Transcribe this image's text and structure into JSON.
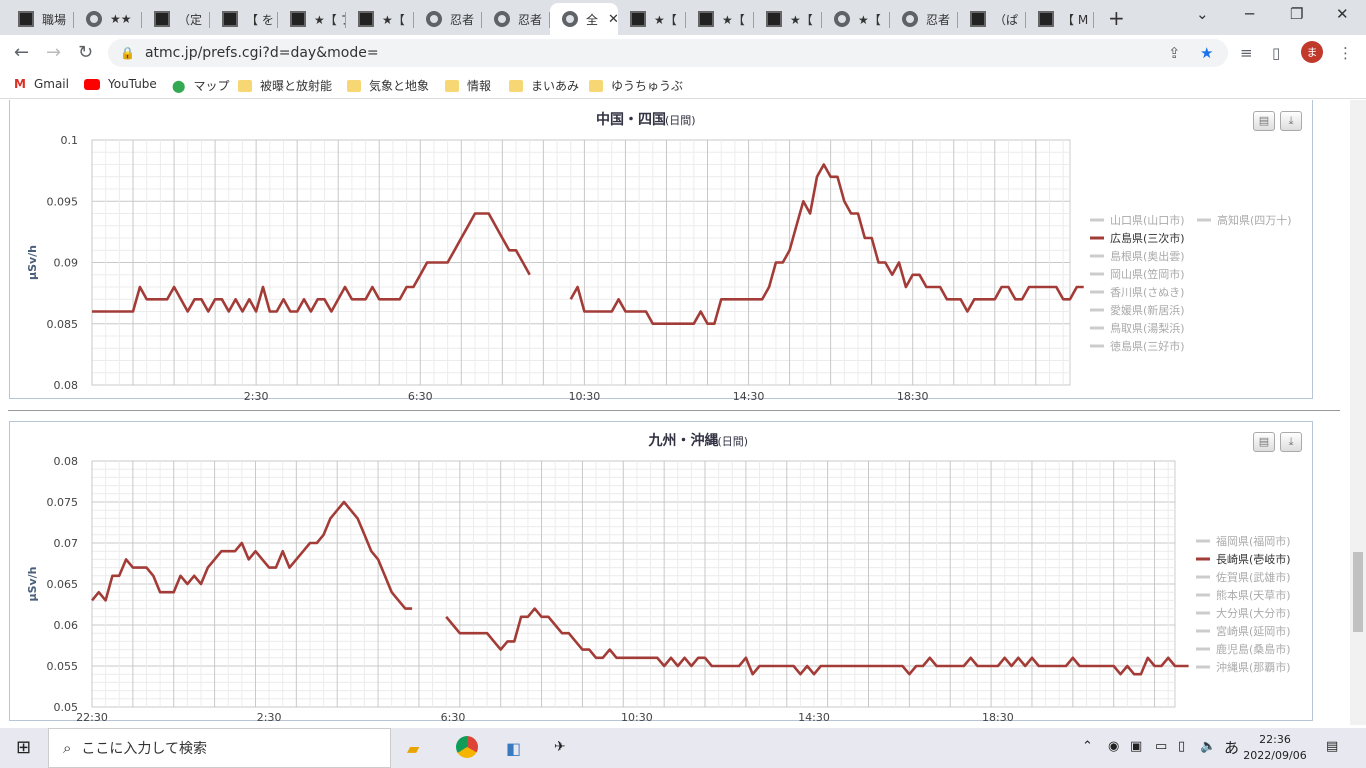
{
  "tabs": [
    {
      "label": "職場",
      "icon": "site-icon"
    },
    {
      "label": "★★",
      "icon": "globe-icon"
    },
    {
      "label": "（定",
      "icon": "site-icon"
    },
    {
      "label": "【 を",
      "icon": "site-icon"
    },
    {
      "label": "★【 プ",
      "icon": "site-icon"
    },
    {
      "label": "★【",
      "icon": "site-icon"
    },
    {
      "label": "忍者",
      "icon": "globe-icon"
    },
    {
      "label": "忍者",
      "icon": "globe-icon"
    },
    {
      "label": "全",
      "icon": "globe-icon"
    },
    {
      "label": "★【",
      "icon": "site-icon"
    },
    {
      "label": "★【",
      "icon": "site-icon"
    },
    {
      "label": "★【",
      "icon": "site-icon"
    },
    {
      "label": "★【",
      "icon": "globe-icon"
    },
    {
      "label": "忍者",
      "icon": "globe-icon"
    },
    {
      "label": "（ぱ",
      "icon": "site-icon"
    },
    {
      "label": "【 M",
      "icon": "site-icon"
    }
  ],
  "url": "atmc.jp/prefs.cgi?d=day&mode=",
  "bookmarks": [
    "Gmail",
    "YouTube",
    "マップ",
    "被曝と放射能",
    "気象と地象",
    "情報",
    "まいあみ",
    "ゆうちゅうぶ"
  ],
  "taskbar": {
    "search_placeholder": "ここに入力して検索",
    "time": "22:36",
    "date": "2022/09/06",
    "ime": "あ"
  },
  "chart_data": [
    {
      "type": "line",
      "title": "中国・四国",
      "subtitle": "(日間)",
      "ylabel": "µSv/h",
      "ylim": [
        0.08,
        0.1
      ],
      "yticks": [
        "0.1",
        "0.095",
        "0.09",
        "0.085",
        "0.08"
      ],
      "xticklabels": [
        {
          "label": "2:30",
          "index": 24
        },
        {
          "label": "6:30",
          "index": 48
        },
        {
          "label": "10:30",
          "index": 72
        },
        {
          "label": "14:30",
          "index": 96
        },
        {
          "label": "18:30",
          "index": 120
        }
      ],
      "n_points": 144,
      "legend": {
        "position": "right",
        "columns": [
          [
            "山口県(山口市)",
            "広島県(三次市)",
            "島根県(奥出雲)",
            "岡山県(笠岡市)",
            "香川県(さぬき)",
            "愛媛県(新居浜)",
            "鳥取県(湯梨浜)",
            "徳島県(三好市)"
          ],
          [
            "高知県(四万十)"
          ]
        ]
      },
      "highlight": "広島県(三次市)",
      "series": [
        {
          "name": "広島県(三次市)",
          "color": "#a33b37",
          "values": [
            0.086,
            0.086,
            0.086,
            0.086,
            0.086,
            0.086,
            0.086,
            0.088,
            0.087,
            0.087,
            0.087,
            0.087,
            0.088,
            0.087,
            0.086,
            0.087,
            0.087,
            0.086,
            0.087,
            0.087,
            0.086,
            0.087,
            0.086,
            0.087,
            0.086,
            0.088,
            0.086,
            0.086,
            0.087,
            0.086,
            0.086,
            0.087,
            0.086,
            0.087,
            0.087,
            0.086,
            0.087,
            0.088,
            0.087,
            0.087,
            0.087,
            0.088,
            0.087,
            0.087,
            0.087,
            0.087,
            0.088,
            0.088,
            0.089,
            0.09,
            0.09,
            0.09,
            0.09,
            0.091,
            0.092,
            0.093,
            0.094,
            0.094,
            0.094,
            0.093,
            0.092,
            0.091,
            0.091,
            0.09,
            0.089,
            null,
            null,
            null,
            null,
            null,
            0.087,
            0.088,
            0.086,
            0.086,
            0.086,
            0.086,
            0.086,
            0.087,
            0.086,
            0.086,
            0.086,
            0.086,
            0.085,
            0.085,
            0.085,
            0.085,
            0.085,
            0.085,
            0.085,
            0.086,
            0.085,
            0.085,
            0.087,
            0.087,
            0.087,
            0.087,
            0.087,
            0.087,
            0.087,
            0.088,
            0.09,
            0.09,
            0.091,
            0.093,
            0.095,
            0.094,
            0.097,
            0.098,
            0.097,
            0.097,
            0.095,
            0.094,
            0.094,
            0.092,
            0.092,
            0.09,
            0.09,
            0.089,
            0.09,
            0.088,
            0.089,
            0.089,
            0.088,
            0.088,
            0.088,
            0.087,
            0.087,
            0.087,
            0.086,
            0.087,
            0.087,
            0.087,
            0.087,
            0.088,
            0.088,
            0.087,
            0.087,
            0.088,
            0.088,
            0.088,
            0.088,
            0.088,
            0.087,
            0.087,
            0.088,
            0.088
          ]
        }
      ]
    },
    {
      "type": "line",
      "title": "九州・沖縄",
      "subtitle": "(日間)",
      "ylabel": "µSv/h",
      "ylim": [
        0.05,
        0.08
      ],
      "yticks": [
        "0.08",
        "0.075",
        "0.07",
        "0.065",
        "0.06",
        "0.055",
        "0.05"
      ],
      "xticklabels": [
        {
          "label": "22:30",
          "index": 0
        },
        {
          "label": "2:30",
          "index": 26
        },
        {
          "label": "6:30",
          "index": 53
        },
        {
          "label": "10:30",
          "index": 80
        },
        {
          "label": "14:30",
          "index": 106
        },
        {
          "label": "18:30",
          "index": 133
        }
      ],
      "n_points": 160,
      "legend": {
        "position": "right",
        "columns": [
          [
            "福岡県(福岡市)",
            "長崎県(壱岐市)",
            "佐賀県(武雄市)",
            "熊本県(天草市)",
            "大分県(大分市)",
            "宮崎県(延岡市)",
            "鹿児島(桑島市)",
            "沖縄県(那覇市)"
          ]
        ]
      },
      "highlight": "長崎県(壱岐市)",
      "series": [
        {
          "name": "長崎県(壱岐市)",
          "color": "#a33b37",
          "values": [
            0.063,
            0.064,
            0.063,
            0.066,
            0.066,
            0.068,
            0.067,
            0.067,
            0.067,
            0.066,
            0.064,
            0.064,
            0.064,
            0.066,
            0.065,
            0.066,
            0.065,
            0.067,
            0.068,
            0.069,
            0.069,
            0.069,
            0.07,
            0.068,
            0.069,
            0.068,
            0.067,
            0.067,
            0.069,
            0.067,
            0.068,
            0.069,
            0.07,
            0.07,
            0.071,
            0.073,
            0.074,
            0.075,
            0.074,
            0.073,
            0.071,
            0.069,
            0.068,
            0.066,
            0.064,
            0.063,
            0.062,
            0.062,
            null,
            null,
            null,
            null,
            0.061,
            0.06,
            0.059,
            0.059,
            0.059,
            0.059,
            0.059,
            0.058,
            0.057,
            0.058,
            0.058,
            0.061,
            0.061,
            0.062,
            0.061,
            0.061,
            0.06,
            0.059,
            0.059,
            0.058,
            0.057,
            0.057,
            0.056,
            0.056,
            0.057,
            0.056,
            0.056,
            0.056,
            0.056,
            0.056,
            0.056,
            0.056,
            0.055,
            0.056,
            0.055,
            0.056,
            0.055,
            0.056,
            0.056,
            0.055,
            0.055,
            0.055,
            0.055,
            0.055,
            0.056,
            0.054,
            0.055,
            0.055,
            0.055,
            0.055,
            0.055,
            0.055,
            0.054,
            0.055,
            0.054,
            0.055,
            0.055,
            0.055,
            0.055,
            0.055,
            0.055,
            0.055,
            0.055,
            0.055,
            0.055,
            0.055,
            0.055,
            0.055,
            0.054,
            0.055,
            0.055,
            0.056,
            0.055,
            0.055,
            0.055,
            0.055,
            0.055,
            0.056,
            0.055,
            0.055,
            0.055,
            0.055,
            0.056,
            0.055,
            0.056,
            0.055,
            0.056,
            0.055,
            0.055,
            0.055,
            0.055,
            0.055,
            0.056,
            0.055,
            0.055,
            0.055,
            0.055,
            0.055,
            0.055,
            0.054,
            0.055,
            0.054,
            0.054,
            0.056,
            0.055,
            0.055,
            0.056,
            0.055,
            0.055,
            0.055
          ]
        }
      ]
    }
  ]
}
